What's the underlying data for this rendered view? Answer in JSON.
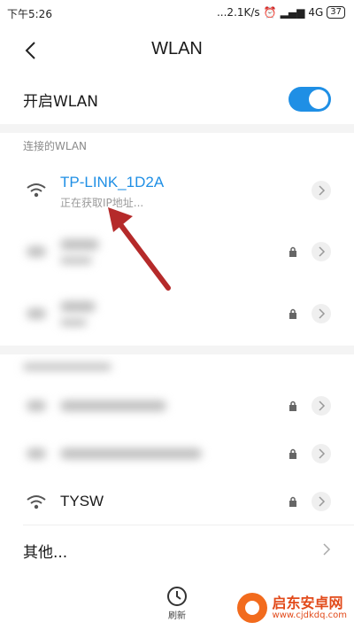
{
  "statusbar": {
    "time": "下午5:26",
    "speed": "...2.1K/s",
    "network": "4G",
    "battery": "37"
  },
  "header": {
    "title": "WLAN"
  },
  "wlan_toggle": {
    "label": "开启WLAN",
    "enabled": true,
    "accent": "#1f8fe5"
  },
  "connected": {
    "section_label": "连接的WLAN",
    "network": {
      "name": "TP-LINK_1D2A",
      "status": "正在获取IP地址...",
      "name_color": "#1f8fe5"
    }
  },
  "saved_networks_obscured": [
    "",
    ""
  ],
  "available_networks": [
    {
      "name": "",
      "locked": true
    },
    {
      "name": "",
      "locked": true
    },
    {
      "name": "TYSW",
      "locked": true
    }
  ],
  "other": {
    "label": "其他..."
  },
  "bottom": {
    "refresh_label": "刷新"
  },
  "watermark": {
    "brand": "启东安卓网",
    "url": "www.cjdkdq.com"
  },
  "annotation": {
    "arrow_color": "#b52a2a"
  }
}
